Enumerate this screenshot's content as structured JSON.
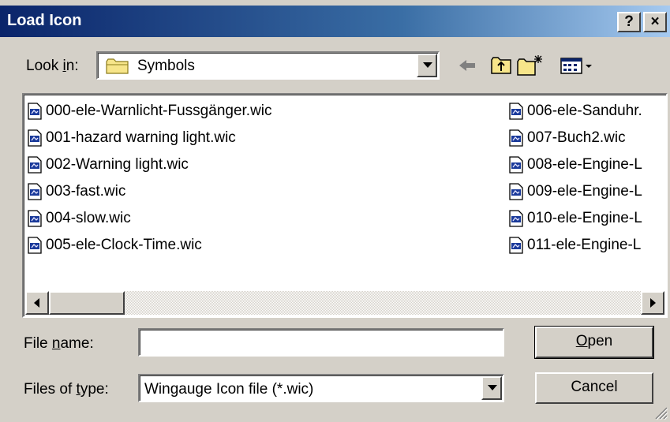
{
  "window": {
    "title": "Load Icon",
    "help_button": "?",
    "close_button": "×"
  },
  "lookin": {
    "label_prefix": "Look ",
    "label_accel": "i",
    "label_suffix": "n:",
    "value": "Symbols"
  },
  "toolbar": {
    "icons": [
      "back-icon",
      "up-folder-icon",
      "new-folder-icon",
      "view-menu-icon"
    ]
  },
  "files": {
    "column1": [
      "000-ele-Warnlicht-Fussgänger.wic",
      "001-hazard warning light.wic",
      "002-Warning light.wic",
      "003-fast.wic",
      "004-slow.wic",
      "005-ele-Clock-Time.wic"
    ],
    "column2": [
      "006-ele-Sanduhr.",
      "007-Buch2.wic",
      "008-ele-Engine-L",
      "009-ele-Engine-L",
      "010-ele-Engine-L",
      "011-ele-Engine-L"
    ]
  },
  "file_name": {
    "label_prefix": "File ",
    "label_accel": "n",
    "label_suffix": "ame:",
    "value": ""
  },
  "file_type": {
    "label_prefix": "Files of ",
    "label_accel": "t",
    "label_suffix": "ype:",
    "value": "Wingauge Icon file (*.wic)"
  },
  "buttons": {
    "open_accel": "O",
    "open_rest": "pen",
    "cancel": "Cancel"
  }
}
